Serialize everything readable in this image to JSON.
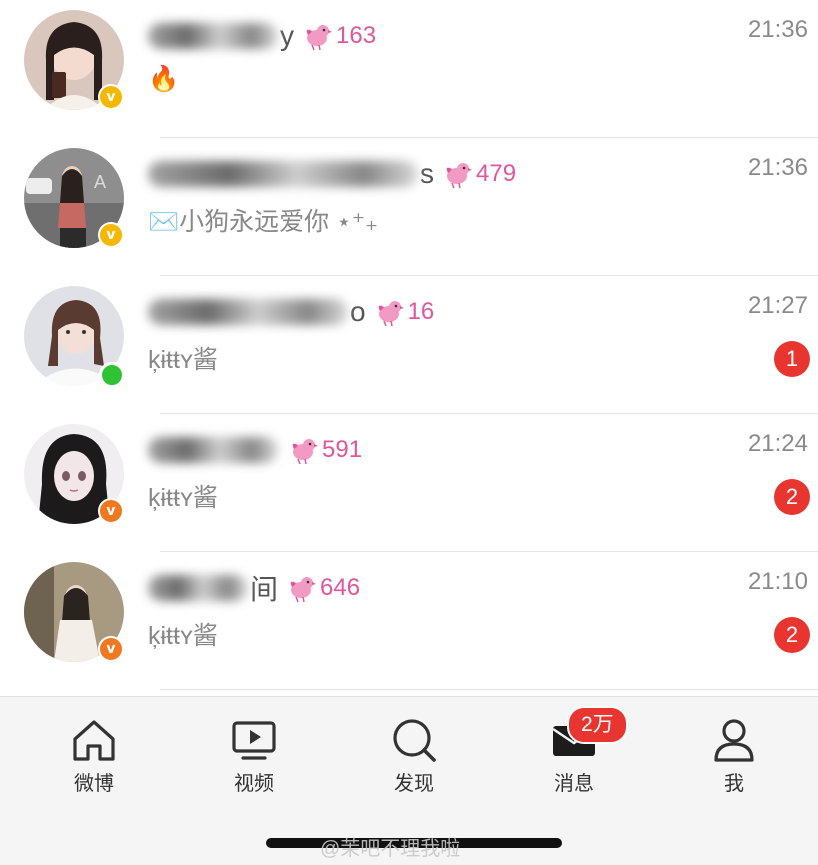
{
  "conversations": [
    {
      "name_tail": "y",
      "fans": "163",
      "time": "21:36",
      "preview_icon": "fire-emoji",
      "preview": "🔥",
      "unread": "",
      "status": "verified-yellow"
    },
    {
      "name_tail": "s",
      "fans": "479",
      "time": "21:36",
      "preview_icon": "envelope-emoji",
      "preview": "✉️小狗永远爱你 ⋆⁺₊",
      "unread": "",
      "status": "verified-yellow"
    },
    {
      "name_tail": "o",
      "fans": "16",
      "time": "21:27",
      "preview_icon": "",
      "preview": "ķɨŧŧʏ酱",
      "unread": "1",
      "status": "online"
    },
    {
      "name_tail": "",
      "fans": "591",
      "time": "21:24",
      "preview_icon": "",
      "preview": "ķɨŧŧʏ酱",
      "unread": "2",
      "status": "verified-orange"
    },
    {
      "name_tail": "间",
      "fans": "646",
      "time": "21:10",
      "preview_icon": "",
      "preview": "ķɨŧŧʏ酱",
      "unread": "2",
      "status": "verified-orange"
    }
  ],
  "badges": {
    "verified_mark": "v"
  },
  "tabbar": {
    "tabs": [
      {
        "label": "微博",
        "icon": "home-icon"
      },
      {
        "label": "视频",
        "icon": "video-icon"
      },
      {
        "label": "发现",
        "icon": "search-icon"
      },
      {
        "label": "消息",
        "icon": "message-icon"
      },
      {
        "label": "我",
        "icon": "profile-icon"
      }
    ],
    "message_badge": "2万"
  },
  "watermark": "@茉吧不理我啦",
  "colors": {
    "fans": "#e0569a",
    "unread": "#e8352f",
    "verified_yellow": "#f5b800",
    "verified_orange": "#f0781e",
    "online": "#2fc233"
  }
}
